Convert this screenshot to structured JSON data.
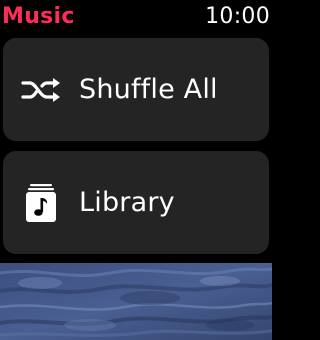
{
  "app": {
    "title": "Music",
    "accent_color": "#ff2d55"
  },
  "status": {
    "time": "10:00"
  },
  "menu": {
    "items": [
      {
        "label": "Shuffle All",
        "icon": "shuffle-icon"
      },
      {
        "label": "Library",
        "icon": "library-music-icon"
      }
    ]
  },
  "artwork": {
    "description_icon": "album-artwork"
  }
}
